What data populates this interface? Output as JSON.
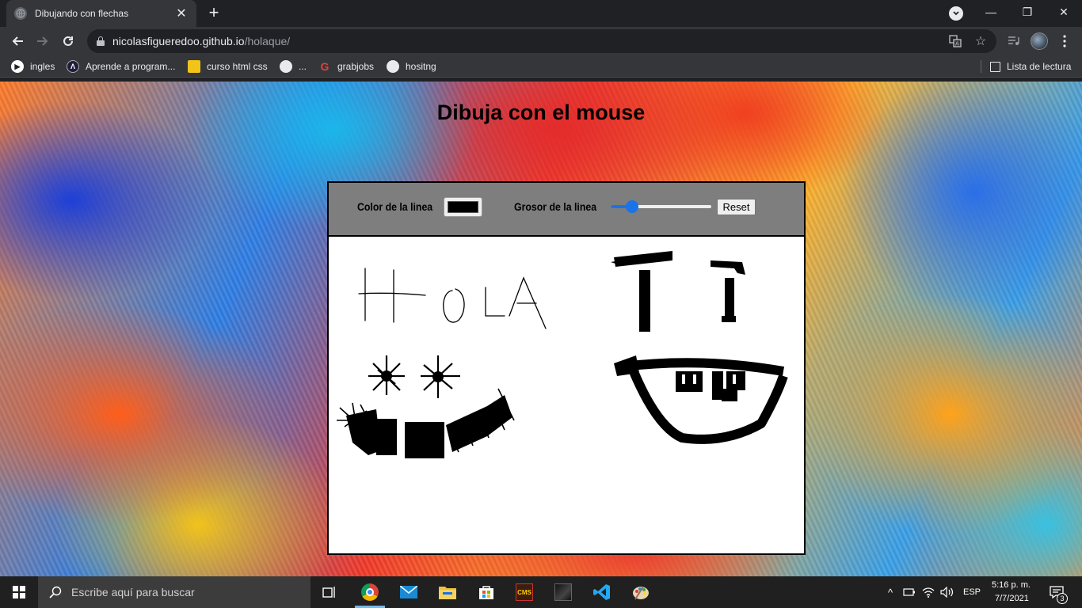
{
  "browser": {
    "tab_title": "Dibujando con flechas",
    "new_tab": "+",
    "url_host": "nicolasfigueredoo.github.io",
    "url_path": "/holaque/",
    "bookmarks": [
      {
        "label": "ingles"
      },
      {
        "label": "Aprende a program..."
      },
      {
        "label": "curso html css"
      },
      {
        "label": "..."
      },
      {
        "label": "grabjobs"
      },
      {
        "label": "hositng"
      }
    ],
    "reading_list": "Lista de lectura"
  },
  "page": {
    "title": "Dibuja con el mouse",
    "controls": {
      "color_label": "Color de la linea",
      "color_value": "#000000",
      "width_label": "Grosor de la linea",
      "width_slider_fraction": 0.17,
      "reset_label": "Reset"
    }
  },
  "taskbar": {
    "search_placeholder": "Escribe aquí para buscar",
    "language": "ESP",
    "time": "5:16 p. m.",
    "date": "7/7/2021",
    "notification_count": "3"
  }
}
